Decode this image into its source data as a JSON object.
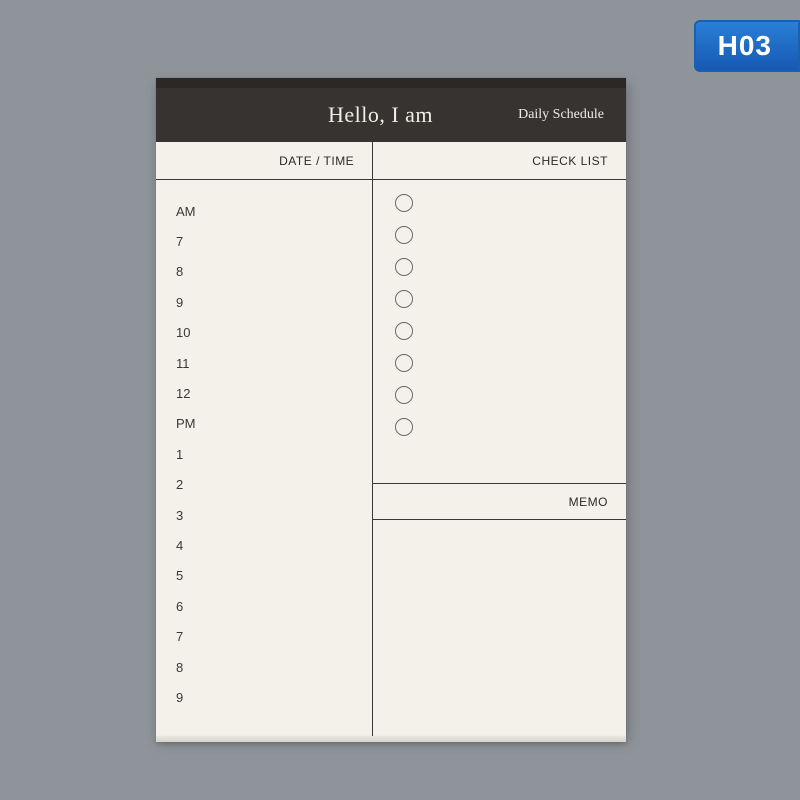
{
  "badge": {
    "label": "H03"
  },
  "notepad": {
    "header": {
      "title": "Hello, I am",
      "subtitle": "Daily Schedule"
    },
    "sections": {
      "datetime_label": "DATE / TIME",
      "checklist_label": "CHECK LIST",
      "memo_label": "MEMO"
    },
    "schedule": {
      "rows": [
        "AM",
        "7",
        "8",
        "9",
        "10",
        "11",
        "12",
        "PM",
        "1",
        "2",
        "3",
        "4",
        "5",
        "6",
        "7",
        "8",
        "9"
      ]
    },
    "checklist": {
      "count": 8
    }
  }
}
